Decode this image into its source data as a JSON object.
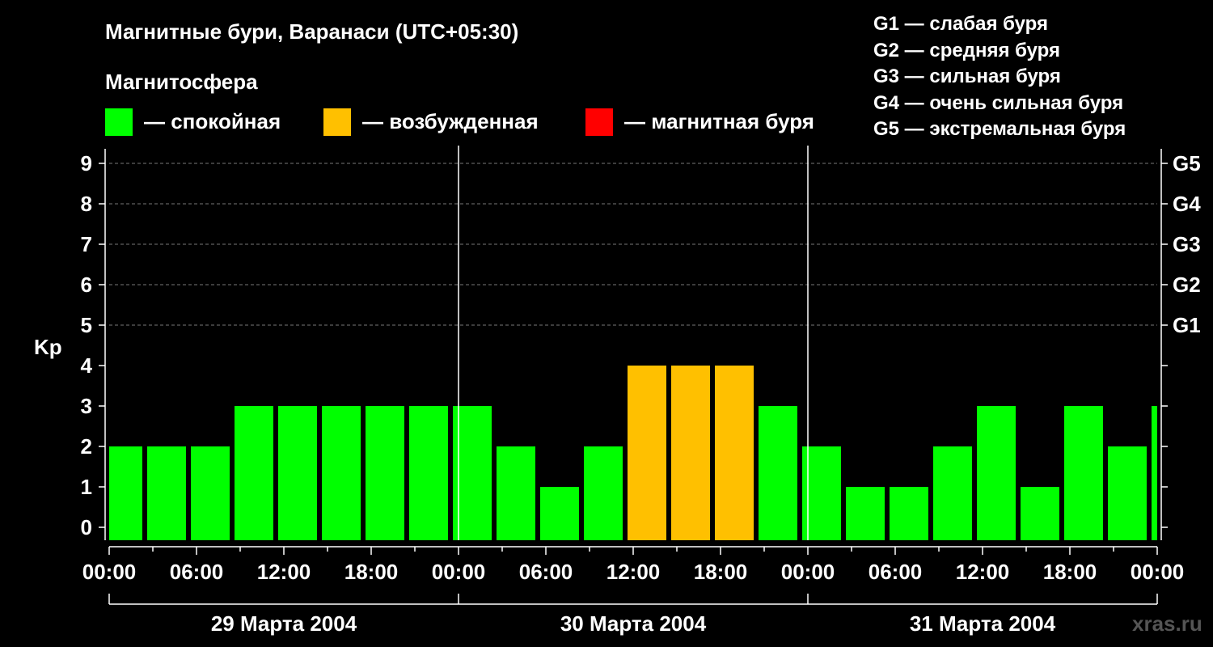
{
  "title": "Магнитные бури, Варанаси (UTC+05:30)",
  "legend": {
    "heading": "Магнитосфера",
    "items": [
      {
        "label": "— спокойная",
        "color": "#00FF00"
      },
      {
        "label": "— возбужденная",
        "color": "#FFC000"
      },
      {
        "label": "— магнитная буря",
        "color": "#FF0000"
      }
    ]
  },
  "g_scale": [
    "G1 — слабая буря",
    "G2 — средняя буря",
    "G3 — сильная буря",
    "G4 — очень сильная буря",
    "G5 — экстремальная буря"
  ],
  "source": "xras.ru",
  "chart_data": {
    "type": "bar",
    "ylabel": "Kp",
    "ylim": [
      0,
      9
    ],
    "yticks": [
      "0",
      "1",
      "2",
      "3",
      "4",
      "5",
      "6",
      "7",
      "8",
      "9"
    ],
    "right_ticks": [
      {
        "value": 5,
        "label": "G1"
      },
      {
        "value": 6,
        "label": "G2"
      },
      {
        "value": 7,
        "label": "G3"
      },
      {
        "value": 8,
        "label": "G4"
      },
      {
        "value": 9,
        "label": "G5"
      }
    ],
    "x_tick_labels": [
      "00:00",
      "06:00",
      "12:00",
      "18:00",
      "00:00",
      "06:00",
      "12:00",
      "18:00",
      "00:00",
      "06:00",
      "12:00",
      "18:00",
      "00:00"
    ],
    "day_labels": [
      "29 Марта 2004",
      "30 Марта 2004",
      "31 Марта 2004"
    ],
    "grid": "dashed at 5–9",
    "bar_colors": {
      "calm": "#00FF00",
      "active": "#FFC000",
      "storm": "#FF0000"
    },
    "bars": [
      {
        "start_hour": -0.5,
        "end_hour": 2.5,
        "value": 2
      },
      {
        "start_hour": 2.5,
        "end_hour": 5.5,
        "value": 2
      },
      {
        "start_hour": 5.5,
        "end_hour": 8.5,
        "value": 2
      },
      {
        "start_hour": 8.5,
        "end_hour": 11.5,
        "value": 3
      },
      {
        "start_hour": 11.5,
        "end_hour": 14.5,
        "value": 3
      },
      {
        "start_hour": 14.5,
        "end_hour": 17.5,
        "value": 3
      },
      {
        "start_hour": 17.5,
        "end_hour": 20.5,
        "value": 3
      },
      {
        "start_hour": 20.5,
        "end_hour": 23.5,
        "value": 3
      },
      {
        "start_hour": 23.5,
        "end_hour": 26.5,
        "value": 3
      },
      {
        "start_hour": 26.5,
        "end_hour": 29.5,
        "value": 2
      },
      {
        "start_hour": 29.5,
        "end_hour": 32.5,
        "value": 1
      },
      {
        "start_hour": 32.5,
        "end_hour": 35.5,
        "value": 2
      },
      {
        "start_hour": 35.5,
        "end_hour": 38.5,
        "value": 4
      },
      {
        "start_hour": 38.5,
        "end_hour": 41.5,
        "value": 4
      },
      {
        "start_hour": 41.5,
        "end_hour": 44.5,
        "value": 4
      },
      {
        "start_hour": 44.5,
        "end_hour": 47.5,
        "value": 3
      },
      {
        "start_hour": 47.5,
        "end_hour": 50.5,
        "value": 2
      },
      {
        "start_hour": 50.5,
        "end_hour": 53.5,
        "value": 1
      },
      {
        "start_hour": 53.5,
        "end_hour": 56.5,
        "value": 1
      },
      {
        "start_hour": 56.5,
        "end_hour": 59.5,
        "value": 2
      },
      {
        "start_hour": 59.5,
        "end_hour": 62.5,
        "value": 3
      },
      {
        "start_hour": 62.5,
        "end_hour": 65.5,
        "value": 1
      },
      {
        "start_hour": 65.5,
        "end_hour": 68.5,
        "value": 3
      },
      {
        "start_hour": 68.5,
        "end_hour": 71.5,
        "value": 2
      },
      {
        "start_hour": 71.5,
        "end_hour": 74.5,
        "value": 3
      }
    ]
  }
}
